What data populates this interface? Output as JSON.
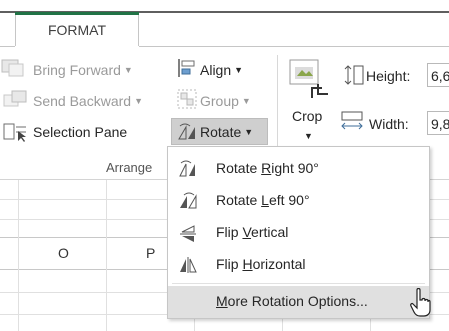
{
  "ribbon_tab": {
    "label": "FORMAT"
  },
  "arrange": {
    "bring_forward": "Bring Forward",
    "send_backward": "Send Backward",
    "selection_pane": "Selection Pane",
    "align": "Align",
    "group": "Group",
    "rotate": "Rotate",
    "group_label": "Arrange"
  },
  "size": {
    "crop": "Crop",
    "height_label": "Height:",
    "height_value": "6,6",
    "width_label": "Width:",
    "width_value": "9,8"
  },
  "sheet": {
    "columns": [
      "O",
      "P"
    ]
  },
  "rotate_menu": {
    "items": [
      {
        "prefix": "Rotate ",
        "accel": "R",
        "suffix": "ight 90°",
        "icon": "rotate-right-icon"
      },
      {
        "prefix": "Rotate ",
        "accel": "L",
        "suffix": "eft 90°",
        "icon": "rotate-left-icon"
      },
      {
        "prefix": "Flip ",
        "accel": "V",
        "suffix": "ertical",
        "icon": "flip-vertical-icon"
      },
      {
        "prefix": "Flip ",
        "accel": "H",
        "suffix": "orizontal",
        "icon": "flip-horizontal-icon"
      },
      {
        "prefix": "",
        "accel": "M",
        "suffix": "ore Rotation Options...",
        "icon": ""
      }
    ]
  },
  "colors": {
    "accent": "#217346",
    "hover": "#e0e0e0",
    "pressed": "#cfcfcf"
  }
}
